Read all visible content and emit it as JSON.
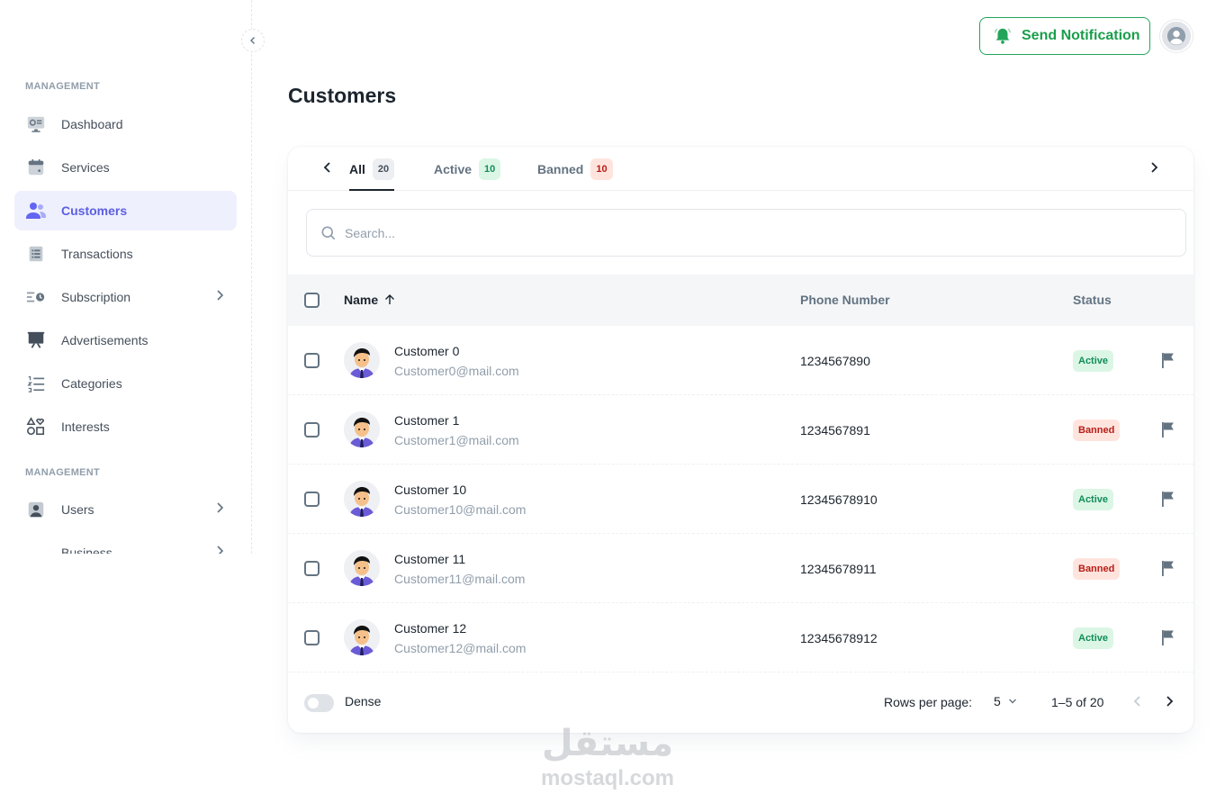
{
  "sidebar": {
    "sections": [
      {
        "label": "MANAGEMENT"
      },
      {
        "label": "MANAGEMENT"
      }
    ],
    "items": [
      {
        "label": "Dashboard"
      },
      {
        "label": "Services"
      },
      {
        "label": "Customers"
      },
      {
        "label": "Transactions"
      },
      {
        "label": "Subscription"
      },
      {
        "label": "Advertisements"
      },
      {
        "label": "Categories"
      },
      {
        "label": "Interests"
      },
      {
        "label": "Users"
      },
      {
        "label": "Business"
      }
    ]
  },
  "header": {
    "notify_label": "Send Notification"
  },
  "page": {
    "title": "Customers"
  },
  "tabs": [
    {
      "label": "All",
      "count": "20"
    },
    {
      "label": "Active",
      "count": "10"
    },
    {
      "label": "Banned",
      "count": "10"
    }
  ],
  "search": {
    "placeholder": "Search..."
  },
  "table": {
    "columns": {
      "name": "Name",
      "phone": "Phone Number",
      "status": "Status"
    },
    "rows": [
      {
        "name": "Customer 0",
        "email": "Customer0@mail.com",
        "phone": "1234567890",
        "status": "Active"
      },
      {
        "name": "Customer 1",
        "email": "Customer1@mail.com",
        "phone": "1234567891",
        "status": "Banned"
      },
      {
        "name": "Customer 10",
        "email": "Customer10@mail.com",
        "phone": "12345678910",
        "status": "Active"
      },
      {
        "name": "Customer 11",
        "email": "Customer11@mail.com",
        "phone": "12345678911",
        "status": "Banned"
      },
      {
        "name": "Customer 12",
        "email": "Customer12@mail.com",
        "phone": "12345678912",
        "status": "Active"
      }
    ]
  },
  "footer": {
    "dense_label": "Dense",
    "rows_per_page_label": "Rows per page:",
    "rows_per_page_value": "5",
    "range": "1–5 of 20"
  },
  "watermark": {
    "arabic": "مستقل",
    "latin": "mostaql.com"
  },
  "colors": {
    "accent": "#6366f1",
    "notify_green": "#22a55a",
    "active_bg": "#dbf6e5",
    "banned_bg": "#ffe4de"
  }
}
